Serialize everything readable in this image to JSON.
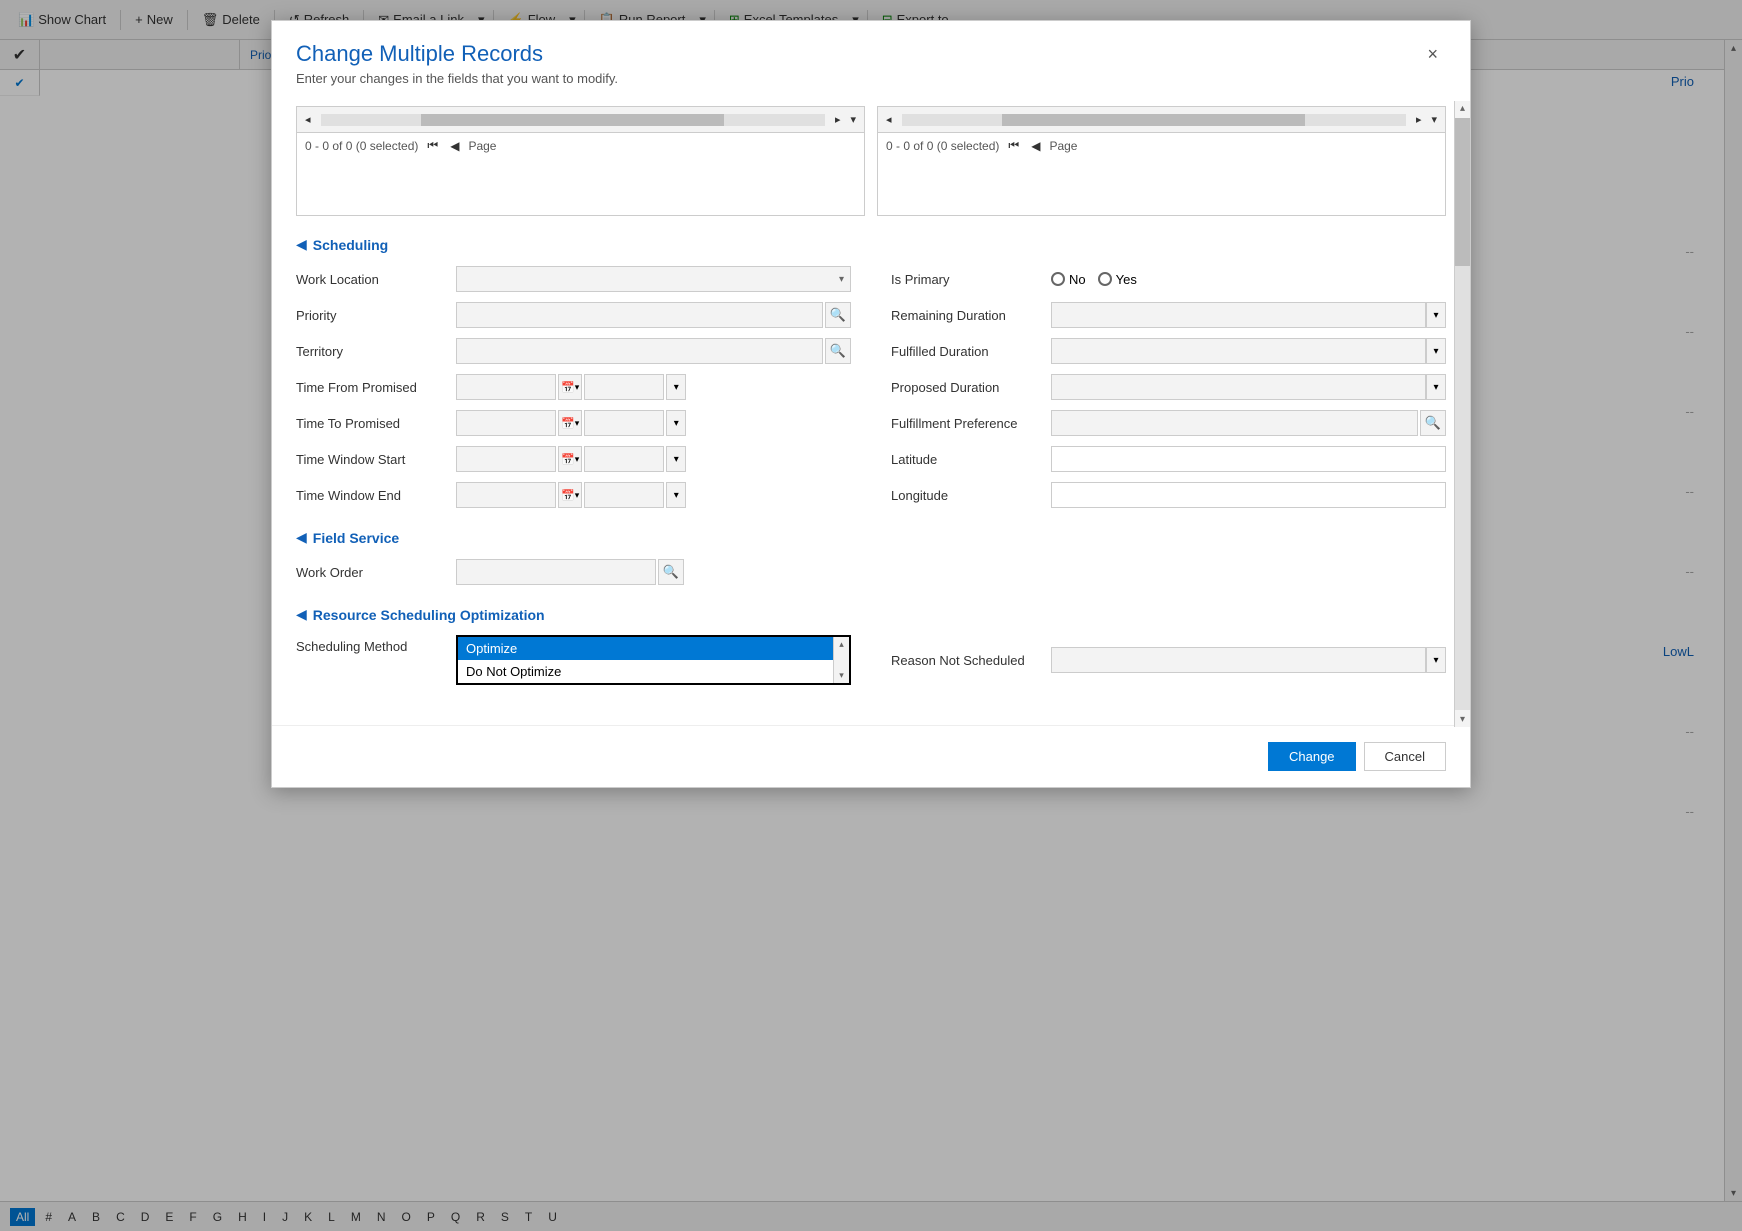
{
  "toolbar": {
    "show_chart": "Show Chart",
    "new": "New",
    "delete": "Delete",
    "refresh": "Refresh",
    "email_link": "Email a Link",
    "flow": "Flow",
    "run_report": "Run Report",
    "excel_templates": "Excel Templates",
    "export_to": "Export to"
  },
  "modal": {
    "title": "Change Multiple Records",
    "subtitle": "Enter your changes in the fields that you want to modify.",
    "close_label": "×"
  },
  "list_panels": [
    {
      "id": "panel1",
      "status_text": "0 - 0 of 0 (0 selected)",
      "page_label": "Page"
    },
    {
      "id": "panel2",
      "status_text": "0 - 0 of 0 (0 selected)",
      "page_label": "Page"
    }
  ],
  "sections": {
    "scheduling": {
      "title": "Scheduling",
      "fields": {
        "work_location": "Work Location",
        "priority": "Priority",
        "territory": "Territory",
        "time_from_promised": "Time From Promised",
        "time_to_promised": "Time To Promised",
        "time_window_start": "Time Window Start",
        "time_window_end": "Time Window End",
        "is_primary": "Is Primary",
        "remaining_duration": "Remaining Duration",
        "fulfilled_duration": "Fulfilled Duration",
        "proposed_duration": "Proposed Duration",
        "fulfillment_preference": "Fulfillment Preference",
        "latitude": "Latitude",
        "longitude": "Longitude"
      },
      "radio_no": "No",
      "radio_yes": "Yes"
    },
    "field_service": {
      "title": "Field Service",
      "fields": {
        "work_order": "Work Order"
      }
    },
    "resource_scheduling": {
      "title": "Resource Scheduling Optimization",
      "fields": {
        "scheduling_method": "Scheduling Method",
        "reason_not_scheduled": "Reason Not Scheduled"
      },
      "dropdown_options": [
        {
          "label": "Optimize",
          "selected": true
        },
        {
          "label": "Do Not Optimize",
          "selected": false
        }
      ]
    }
  },
  "footer": {
    "change_label": "Change",
    "cancel_label": "Cancel"
  },
  "bottom_bar": {
    "letters": [
      "All",
      "#",
      "A",
      "B",
      "C",
      "D",
      "E",
      "F",
      "G",
      "H",
      "I",
      "J",
      "K",
      "L",
      "M",
      "N",
      "O",
      "P",
      "Q",
      "R",
      "S",
      "T",
      "U"
    ],
    "active": "All"
  },
  "right_side_labels": {
    "prio": "Prio",
    "lowl": "LowL"
  },
  "icons": {
    "chevron_down": "▾",
    "chevron_up": "▴",
    "chevron_left": "◂",
    "chevron_right": "▸",
    "calendar": "📅",
    "search": "🔍",
    "close": "×",
    "check": "✔",
    "first_page": "⏮",
    "prev_page": "◀",
    "next_page": "▶",
    "last_page": "⏭",
    "nav_first": "⏮",
    "nav_prev": "◀"
  }
}
